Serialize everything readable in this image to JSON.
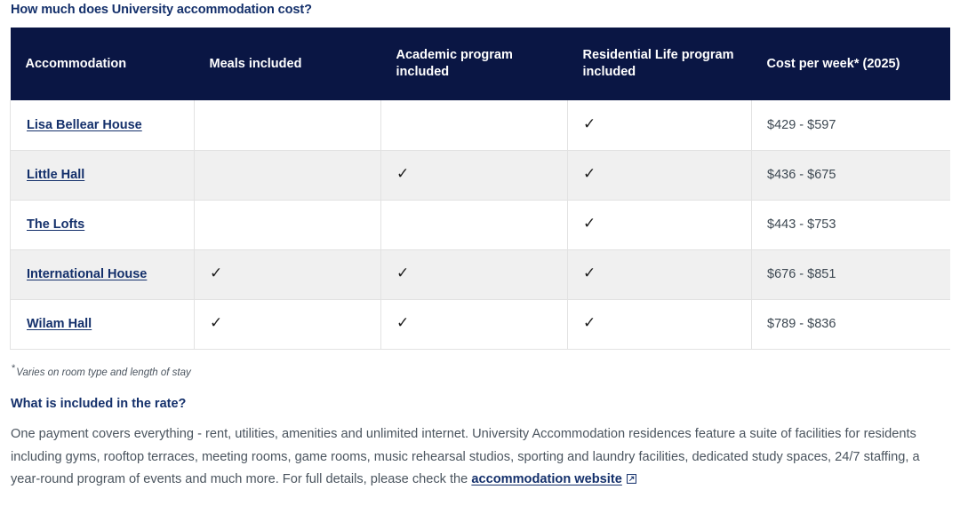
{
  "section": {
    "heading": "How much does University accommodation cost?",
    "heading_2": "What is included in the rate?"
  },
  "table": {
    "columns": [
      "Accommodation",
      "Meals included",
      "Academic program included",
      "Residential Life program included",
      "Cost per week* (2025)"
    ],
    "tick_glyph": "✓",
    "rows": [
      {
        "name": "Lisa Bellear House",
        "meals": "",
        "academic": "",
        "residential": "✓",
        "cost": "$429 - $597"
      },
      {
        "name": "Little Hall",
        "meals": "",
        "academic": "✓",
        "residential": "✓",
        "cost": "$436 - $675"
      },
      {
        "name": "The Lofts",
        "meals": "",
        "academic": "",
        "residential": "✓",
        "cost": "$443 - $753"
      },
      {
        "name": "International House",
        "meals": "✓",
        "academic": "✓",
        "residential": "✓",
        "cost": "$676 - $851"
      },
      {
        "name": "Wilam Hall",
        "meals": "✓",
        "academic": "✓",
        "residential": "✓",
        "cost": "$789 - $836"
      }
    ]
  },
  "footnote": {
    "marker": "*",
    "text": "Varies on room type and length of stay"
  },
  "paragraph": {
    "before_link": "One payment covers everything - rent, utilities, amenities and unlimited internet. University Accommodation residences feature a suite of facilities for residents including gyms, rooftop terraces, meeting rooms, game rooms, music rehearsal studios, sporting and laundry facilities, dedicated study spaces, 24/7 staffing, a year-round program of events and much more. For full details, please check the ",
    "link_text": "accommodation website",
    "external_icon": "external-link-icon"
  },
  "colors": {
    "header_navy": "#0a1644",
    "link_navy": "#14306b",
    "alt_row": "#f0f0f0",
    "body_text": "#4a545e",
    "border": "#e2e2e2"
  }
}
